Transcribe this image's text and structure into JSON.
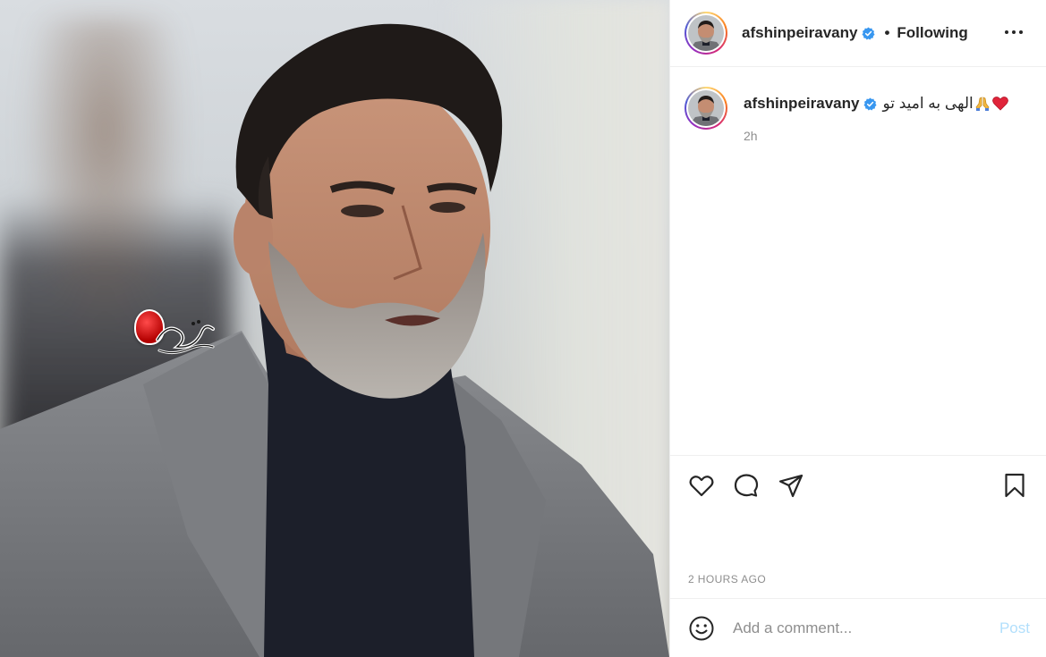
{
  "post": {
    "author": {
      "username": "afshinpeiravany",
      "verified": true,
      "follow_status": "Following",
      "separator": "•"
    },
    "caption": {
      "username": "afshinpeiravany",
      "text": "الهی به امید تو",
      "emojis": [
        "red-heart",
        "folded-hands"
      ],
      "time": "2h"
    },
    "photo": {
      "watermark_text": "هومن قادری"
    },
    "actions": [
      "like-icon",
      "comment-icon",
      "share-icon",
      "save-icon"
    ],
    "posted_ago": "2 HOURS AGO",
    "comment_box": {
      "placeholder": "Add a comment...",
      "post_label": "Post"
    },
    "colors": {
      "post_button_disabled": "#b2dffc",
      "verified_blue": "#3897f0",
      "muted_text": "#8e8e8e",
      "border": "#efefef"
    }
  }
}
